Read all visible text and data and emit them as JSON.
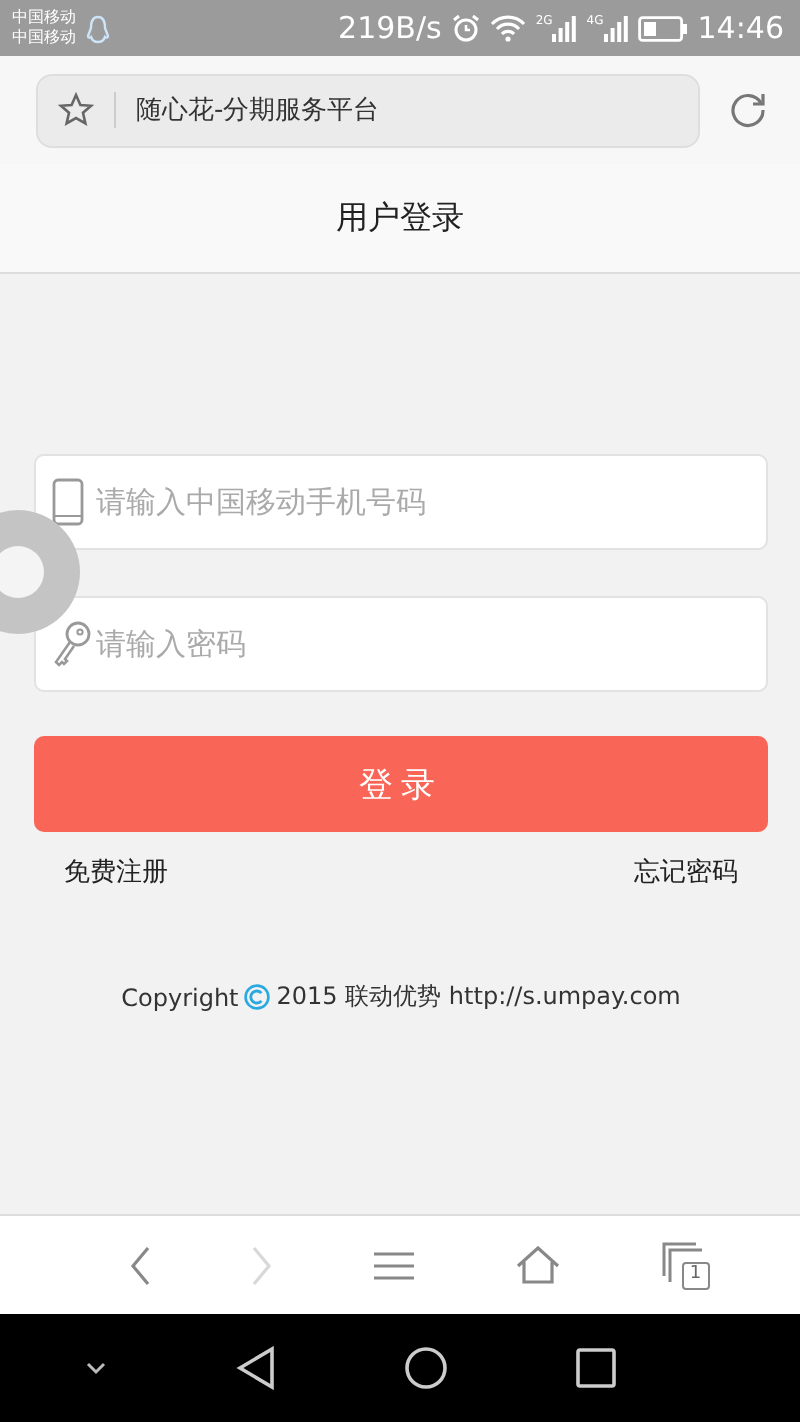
{
  "status_bar": {
    "carriers": [
      "中国移动",
      "中国移动"
    ],
    "speed": "219B/s",
    "signals": [
      {
        "network": "2G"
      },
      {
        "network": "4G"
      }
    ],
    "time": "14:46"
  },
  "address_bar": {
    "title": "随心花-分期服务平台"
  },
  "page": {
    "title": "用户登录"
  },
  "fields": [
    {
      "kind": "phone",
      "placeholder": "请输入中国移动手机号码"
    },
    {
      "kind": "password",
      "placeholder": "请输入密码"
    }
  ],
  "login_button": "登录",
  "links": [
    "免费注册",
    "忘记密码"
  ],
  "footer": {
    "before": "Copyright",
    "after": "2015 联动优势 http://s.umpay.com"
  },
  "toolbar": [
    {
      "kind": "back",
      "disabled": false
    },
    {
      "kind": "forward",
      "disabled": true
    },
    {
      "kind": "menu",
      "disabled": false
    },
    {
      "kind": "home",
      "disabled": false
    },
    {
      "kind": "tabs",
      "disabled": false,
      "count": "1"
    }
  ],
  "nav_bar": [
    {
      "kind": "collapse"
    },
    {
      "kind": "back"
    },
    {
      "kind": "home"
    },
    {
      "kind": "recent"
    }
  ]
}
